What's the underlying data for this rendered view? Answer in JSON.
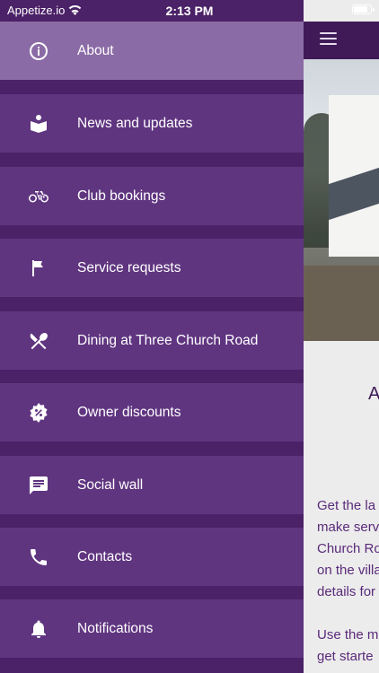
{
  "status_bar": {
    "carrier": "Appetize.io",
    "time": "2:13 PM",
    "wifi_icon": "wifi-icon",
    "battery_level": 0.9
  },
  "drawer": {
    "items": [
      {
        "label": "About",
        "icon": "info-icon",
        "active": true
      },
      {
        "label": "News and updates",
        "icon": "book-reader-icon",
        "active": false
      },
      {
        "label": "Club bookings",
        "icon": "bicycle-icon",
        "active": false
      },
      {
        "label": "Service requests",
        "icon": "flag-icon",
        "active": false
      },
      {
        "label": "Dining at Three Church Road",
        "icon": "fork-knife-icon",
        "active": false
      },
      {
        "label": "Owner discounts",
        "icon": "discount-badge-icon",
        "active": false
      },
      {
        "label": "Social wall",
        "icon": "chat-icon",
        "active": false
      },
      {
        "label": "Contacts",
        "icon": "phone-icon",
        "active": false
      },
      {
        "label": "Notifications",
        "icon": "bell-icon",
        "active": false
      }
    ]
  },
  "background_page": {
    "header_icon": "hamburger-menu-icon",
    "heading_fragment": "A",
    "body_lines": [
      "Get the la",
      "make serv",
      "Church Ro",
      "on the villa",
      "details for"
    ],
    "body_lines_2": [
      "Use the m",
      "get starte"
    ]
  },
  "colors": {
    "drawer_bg": "#4b2167",
    "item_bg": "#603580",
    "active_item_bg": "#8b6ba5",
    "header_bg": "#3f1a57"
  }
}
